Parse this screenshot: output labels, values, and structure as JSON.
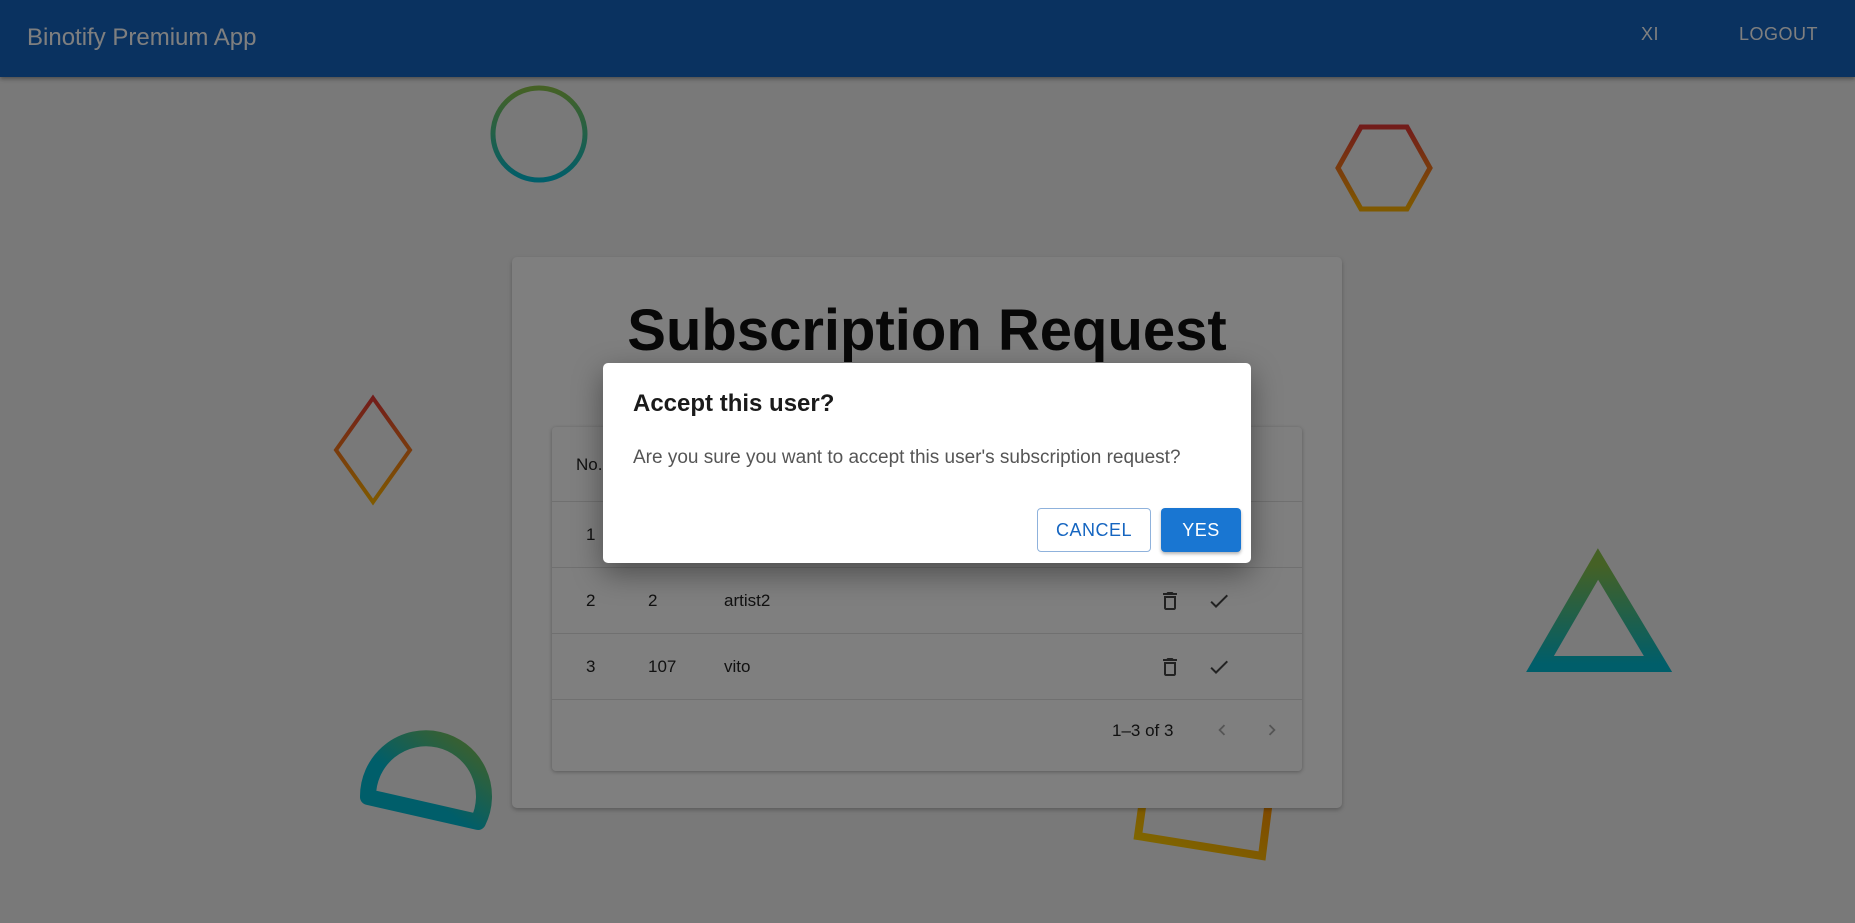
{
  "app": {
    "title": "Binotify Premium App"
  },
  "nav": {
    "user_label": "XI",
    "logout_label": "LOGOUT"
  },
  "page": {
    "title": "Subscription Request"
  },
  "table": {
    "columns": [
      "No."
    ],
    "rows": [
      {
        "no": "1",
        "id": "",
        "name": ""
      },
      {
        "no": "2",
        "id": "2",
        "name": "artist2"
      },
      {
        "no": "3",
        "id": "107",
        "name": "vito"
      }
    ],
    "row_actions": [
      "delete-icon",
      "check-icon"
    ],
    "pagination": {
      "text": "1–3 of 3",
      "prev_icon": "chevron-left-icon",
      "next_icon": "chevron-right-icon"
    }
  },
  "dialog": {
    "title": "Accept this user?",
    "message": "Are you sure you want to accept this user's subscription request?",
    "cancel_label": "CANCEL",
    "confirm_label": "YES"
  },
  "colors": {
    "primary": "#1565c0",
    "button": "#1976d2",
    "backdrop": "rgba(0,0,0,0.5)"
  }
}
